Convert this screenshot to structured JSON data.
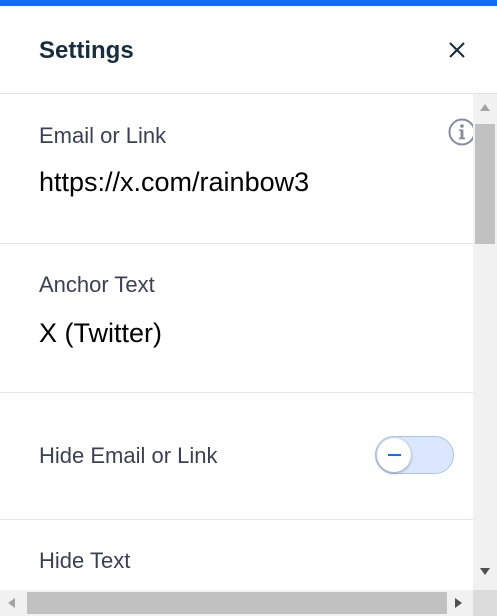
{
  "panel": {
    "title": "Settings",
    "accent_color": "#116dff"
  },
  "fields": {
    "email_or_link": {
      "label": "Email or Link",
      "value": "https://x.com/rainbow3"
    },
    "anchor_text": {
      "label": "Anchor Text",
      "value": "X (Twitter)"
    },
    "hide_email_or_link": {
      "label": "Hide Email or Link",
      "toggle_state": "off"
    },
    "hide_text": {
      "label": "Hide Text"
    }
  },
  "icons": {
    "close": "close-icon",
    "info": "info-icon"
  }
}
